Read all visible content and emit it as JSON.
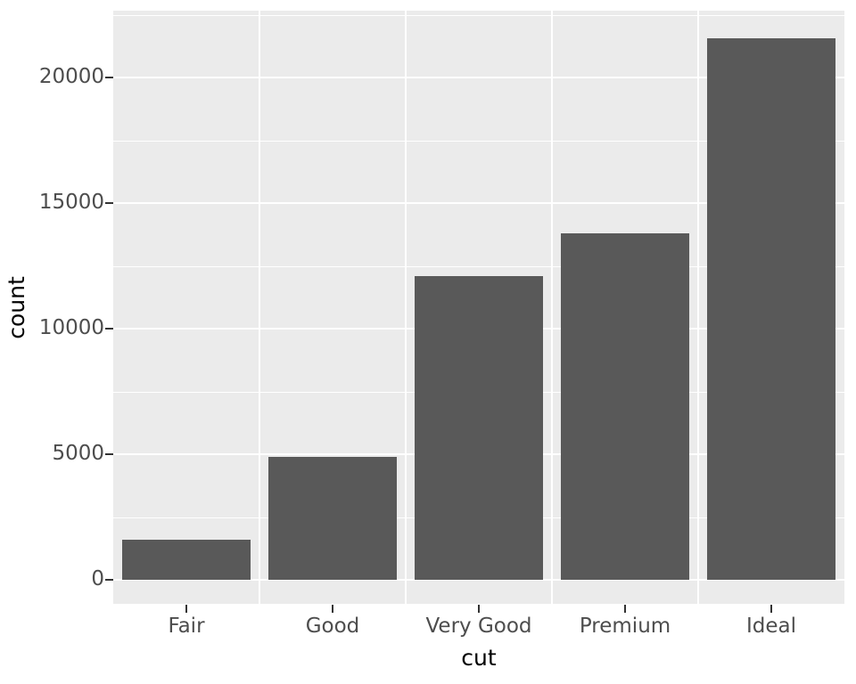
{
  "chart_data": {
    "type": "bar",
    "title": "",
    "subtitle": "",
    "xlabel": "cut",
    "ylabel": "count",
    "categories": [
      "Fair",
      "Good",
      "Very Good",
      "Premium",
      "Ideal"
    ],
    "values": [
      1610,
      4906,
      12082,
      13791,
      21551
    ],
    "series": [
      {
        "name": "count",
        "values": [
          1610,
          4906,
          12082,
          13791,
          21551
        ]
      }
    ],
    "ylim": [
      0,
      22300
    ],
    "xlim_categories": 5,
    "y_ticks": [
      0,
      5000,
      10000,
      15000,
      20000
    ],
    "y_tick_labels": [
      "0",
      "5000",
      "10000",
      "15000",
      "20000"
    ],
    "y_minor_ticks": [
      2500,
      7500,
      12500,
      17500,
      22500
    ],
    "x_tick_labels": [
      "Fair",
      "Good",
      "Very Good",
      "Premium",
      "Ideal"
    ],
    "grid": true,
    "grid_major_color": "#FFFFFF",
    "grid_minor_color": "#FFFFFF",
    "panel_background": "#EBEBEB",
    "bar_color": "#595959",
    "axis_text_color": "#4D4D4D",
    "axis_title_color": "#000000",
    "tick_mark_color": "#333333",
    "legend": null,
    "legend_position": "none"
  },
  "axes": {
    "y_title": "count",
    "x_title": "cut"
  },
  "y_ticks": [
    {
      "label": "20000",
      "value": 20000
    },
    {
      "label": "15000",
      "value": 15000
    },
    {
      "label": "10000",
      "value": 10000
    },
    {
      "label": "5000",
      "value": 5000
    },
    {
      "label": "0",
      "value": 0
    }
  ],
  "x_ticks": [
    {
      "label": "Fair"
    },
    {
      "label": "Good"
    },
    {
      "label": "Very Good"
    },
    {
      "label": "Premium"
    },
    {
      "label": "Ideal"
    }
  ],
  "bars": [
    {
      "label": "Fair",
      "value": 1610
    },
    {
      "label": "Good",
      "value": 4906
    },
    {
      "label": "Very Good",
      "value": 12082
    },
    {
      "label": "Premium",
      "value": 13791
    },
    {
      "label": "Ideal",
      "value": 21551
    }
  ]
}
